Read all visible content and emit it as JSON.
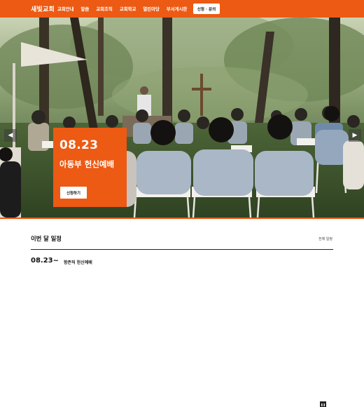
{
  "header": {
    "logo": "새빛교회",
    "nav": [
      "교회안내",
      "말씀",
      "교회조직",
      "교회학교",
      "열린마당",
      "부서게시판"
    ],
    "cta_label": "신청 · 문의"
  },
  "hero": {
    "date": "08.23",
    "title": "아동부 헌신예배",
    "button_label": "신청하기",
    "prev_icon": "chevron-left-icon",
    "next_icon": "chevron-right-icon",
    "pause_icon": "pause-icon"
  },
  "schedule": {
    "title": "이번 달 일정",
    "all_label": "전체 일정",
    "items": [
      {
        "date": "08.23~",
        "event": "항존직 헌신예배"
      }
    ]
  },
  "colors": {
    "accent": "#ec5a14",
    "dark": "#222222",
    "white": "#ffffff"
  }
}
